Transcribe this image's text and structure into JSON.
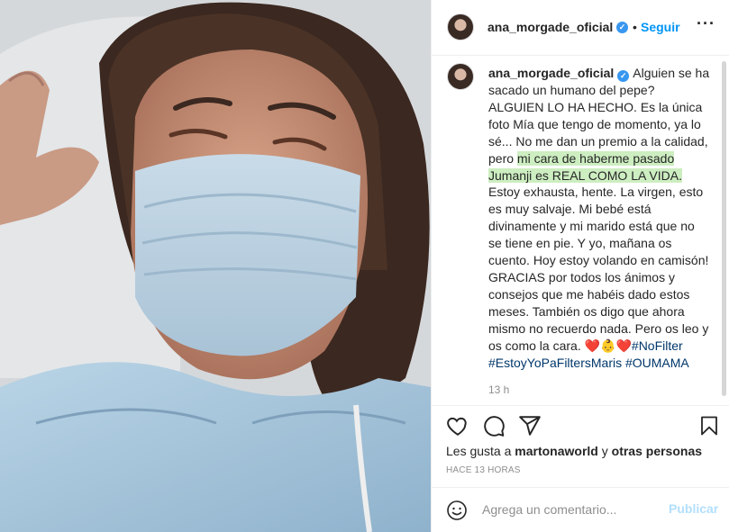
{
  "post": {
    "username": "ana_morgade_oficial",
    "verified_badge": "verified-badge-icon",
    "dot": "•",
    "follow_label": "Seguir",
    "more_icon": "more-options-icon"
  },
  "caption": {
    "text_1": "Alguien se ha sacado un humano del pepe? ALGUIEN LO HA HECHO. Es la única foto Mía que tengo de momento, ya lo sé... No me dan un premio a la calidad, pero ",
    "highlight": "mi cara de haberme pasado Jumanji es REAL COMO LA VIDA.",
    "text_2": " Estoy exhausta, hente. La virgen, esto es muy salvaje. Mi bebé está divinamente y mi marido está que no se tiene en pie. Y yo, mañana os cuento. Hoy estoy volando en camisón! GRACIAS por todos los ánimos y consejos que me habéis dado estos meses. También os digo que ahora mismo no recuerdo nada. Pero os leo y os como la cara. ",
    "emoji": "❤️👶❤️",
    "hashtags": [
      "#NoFilter",
      "#EstoyYoPaFiltersMaris",
      "#OUMAMA"
    ],
    "time": "13 h"
  },
  "actions": {
    "likes_prefix": "Les gusta a ",
    "likes_user": "martonaworld",
    "likes_mid": " y ",
    "likes_others": "otras personas",
    "date": "HACE 13 HORAS"
  },
  "comment": {
    "placeholder": "Agrega un comentario...",
    "publish_label": "Publicar"
  },
  "colors": {
    "accent": "#0095f6",
    "highlight": "#cdeec1",
    "hashtag": "#00376b",
    "muted": "#8e8e8e"
  }
}
